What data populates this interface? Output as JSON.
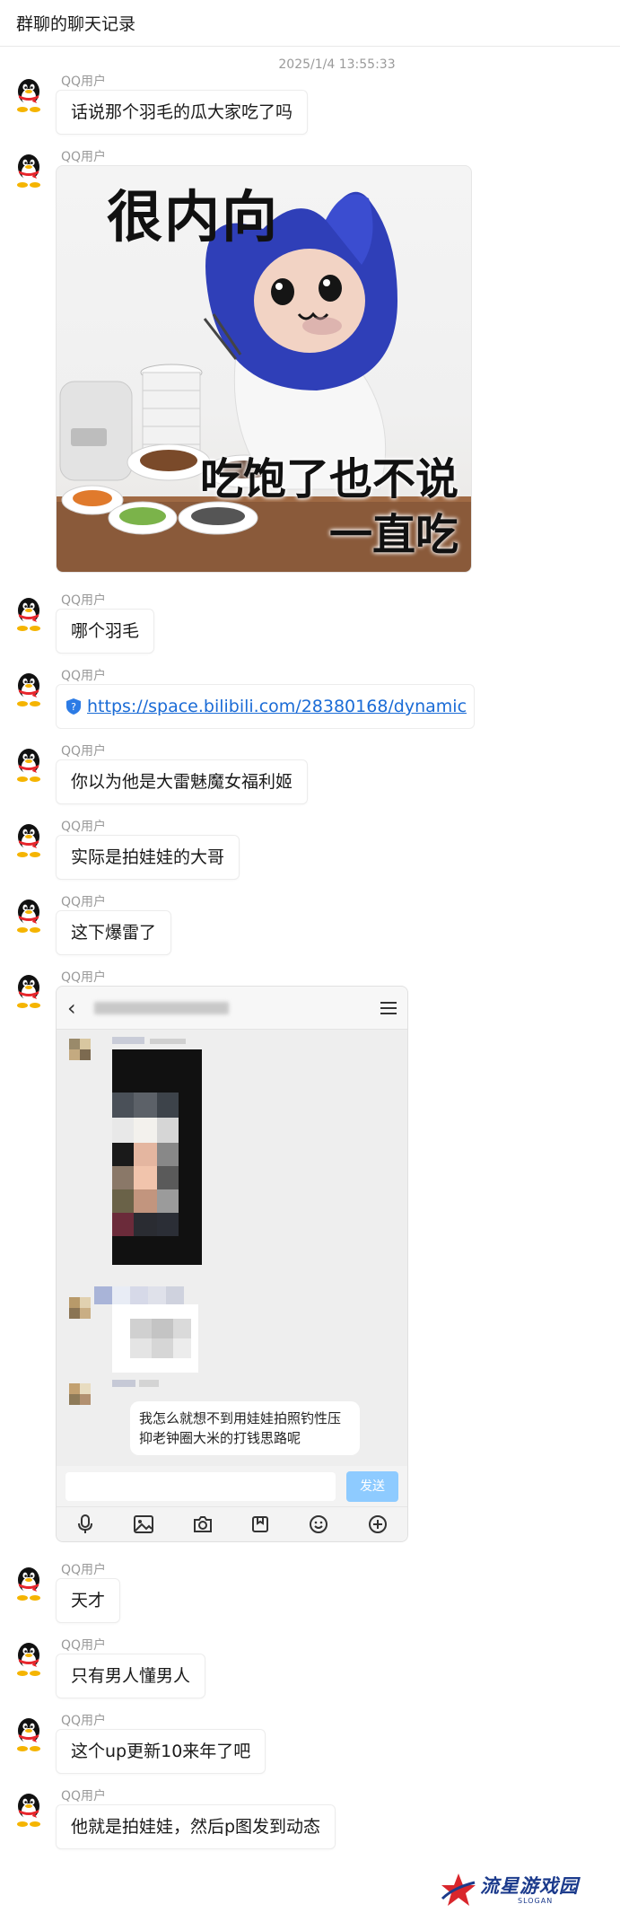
{
  "header": {
    "title": "群聊的聊天记录"
  },
  "timestamp": "2025/1/4 13:55:33",
  "sender_name": "QQ用户",
  "messages": {
    "m1": "话说那个羽毛的瓜大家吃了吗",
    "m3": "哪个羽毛",
    "m4_link": "https://space.bilibili.com/28380168/dynamic",
    "m5": "你以为他是大雷魅魔女福利姬",
    "m6": "实际是拍娃娃的大哥",
    "m7": "这下爆雷了",
    "m9": "天才",
    "m10": "只有男人懂男人",
    "m11": "这个up更新10来年了吧",
    "m12": "他就是拍娃娃，然后p图发到动态"
  },
  "meme": {
    "top_text": "很内向",
    "bottom_line1": "吃饱了也不说",
    "bottom_line2": "一直吃"
  },
  "phone_screenshot": {
    "bubble_text": "我怎么就想不到用娃娃拍照钓性压抑老钟圈大米的打钱思路呢",
    "send_label": "发送"
  },
  "watermark": {
    "name": "流星游戏园",
    "slogan": "SLOGAN"
  },
  "colors": {
    "link": "#1a6bd6",
    "send_button": "#8ecbff",
    "watermark": "#1c3b8c"
  },
  "icons": [
    "qq-penguin-avatar-icon",
    "link-shield-icon",
    "back-chevron-icon",
    "menu-icon",
    "mic-icon",
    "image-icon",
    "camera-icon",
    "bookmark-icon",
    "emoji-icon",
    "plus-icon",
    "star-logo-icon"
  ]
}
